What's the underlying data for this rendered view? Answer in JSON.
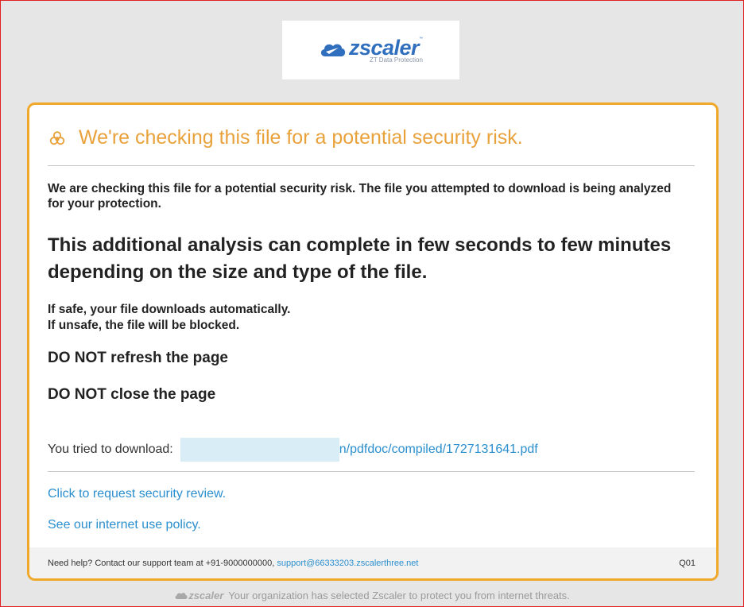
{
  "brand": {
    "logo_text": "zscaler",
    "logo_tagline": "ZT Data Protection",
    "trademark": "™"
  },
  "colors": {
    "accent": "#f0a82b",
    "title": "#e9a23b",
    "link": "#2a8fcf",
    "logo": "#2f6fbd"
  },
  "icons": {
    "header": "biohazard-icon",
    "logo": "zscaler-cloud-icon"
  },
  "card": {
    "title": "We're checking this file for a potential security risk.",
    "intro": "We are checking this file for a potential security risk. The file you attempted to download is being analyzed for your protection.",
    "analysis_note": "This additional analysis can complete in few seconds to few minutes depending on the size and type of the file.",
    "safe_line": "If safe, your file downloads automatically.",
    "unsafe_line": "If unsafe, the file will be blocked.",
    "do_not_refresh_strong": "DO NOT",
    "do_not_refresh_rest": " refresh the page",
    "do_not_close_strong": "DO NOT",
    "do_not_close_rest": " close the page",
    "download_label": "You tried to download:",
    "download_url_visible": "n/pdfdoc/compiled/1727131641.pdf",
    "review_link": "Click to request security review.",
    "policy_link": "See our internet use policy."
  },
  "footer": {
    "help_text": "Need help? Contact our support team at +91-9000000000,",
    "support_email": "support@66333203.zscalerthree.net",
    "code": "Q01"
  },
  "bottom": {
    "logo_text": "zscaler",
    "message": "Your organization has selected Zscaler to protect you from internet threats."
  }
}
